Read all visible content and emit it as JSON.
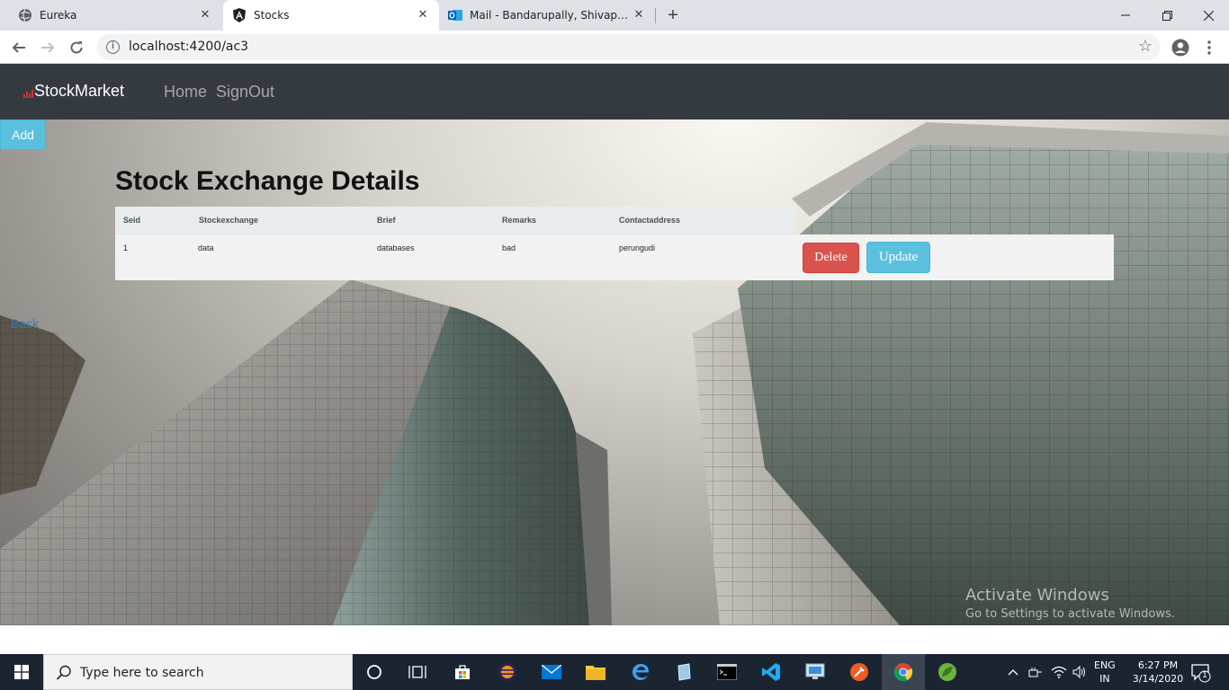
{
  "browser": {
    "tabs": [
      {
        "title": "Eureka",
        "active": false
      },
      {
        "title": "Stocks",
        "active": true
      },
      {
        "title": "Mail - Bandarupally, Shivaprasad",
        "active": false
      }
    ],
    "url": "localhost:4200/ac3"
  },
  "navbar": {
    "brand": "StockMarket",
    "links": [
      "Home",
      "SignOut"
    ]
  },
  "page": {
    "add_label": "Add",
    "heading": "Stock Exchange Details",
    "table": {
      "columns": [
        "Seid",
        "Stockexchange",
        "Brief",
        "Remarks",
        "Contactaddress"
      ],
      "rows": [
        [
          "1",
          "data",
          "databases",
          "bad",
          "perungudi"
        ]
      ],
      "delete_label": "Delete",
      "update_label": "Update"
    },
    "back_label": "Back"
  },
  "watermark": {
    "line1": "Activate Windows",
    "line2": "Go to Settings to activate Windows."
  },
  "taskbar": {
    "search_placeholder": "Type here to search",
    "lang_line1": "ENG",
    "lang_line2": "IN",
    "time": "6:27 PM",
    "date": "3/14/2020",
    "notification_count": "1"
  },
  "colors": {
    "navbar_bg": "#343a40",
    "info_button": "#5bc0de",
    "danger_button": "#d9534f",
    "link": "#337ab7"
  }
}
